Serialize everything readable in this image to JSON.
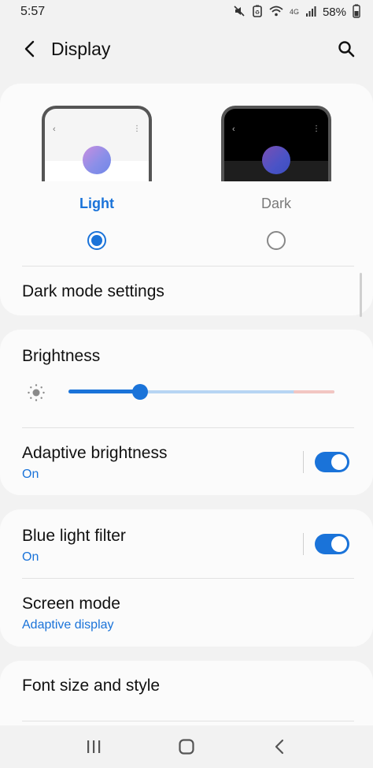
{
  "status_bar": {
    "time": "5:57",
    "network_label": "4G",
    "battery": "58%",
    "icons": [
      "mute-icon",
      "data-saver-icon",
      "wifi-icon",
      "signal-icon",
      "battery-icon"
    ]
  },
  "header": {
    "title": "Display",
    "back_icon": "chevron-left-icon",
    "search_icon": "search-icon"
  },
  "theme": {
    "light_label": "Light",
    "dark_label": "Dark",
    "selected": "light",
    "dark_mode_settings_label": "Dark mode settings"
  },
  "brightness": {
    "title": "Brightness",
    "level_fraction": 0.27,
    "adaptive_title": "Adaptive brightness",
    "adaptive_status": "On",
    "adaptive_enabled": true
  },
  "blue_light": {
    "title": "Blue light filter",
    "status": "On",
    "enabled": true
  },
  "screen_mode": {
    "title": "Screen mode",
    "value": "Adaptive display"
  },
  "font": {
    "title": "Font size and style"
  },
  "colors": {
    "accent": "#1a73d9",
    "background": "#f2f2f2",
    "card": "#fbfbfb"
  },
  "navbar": {
    "icons": [
      "recents-icon",
      "home-icon",
      "back-icon"
    ]
  }
}
